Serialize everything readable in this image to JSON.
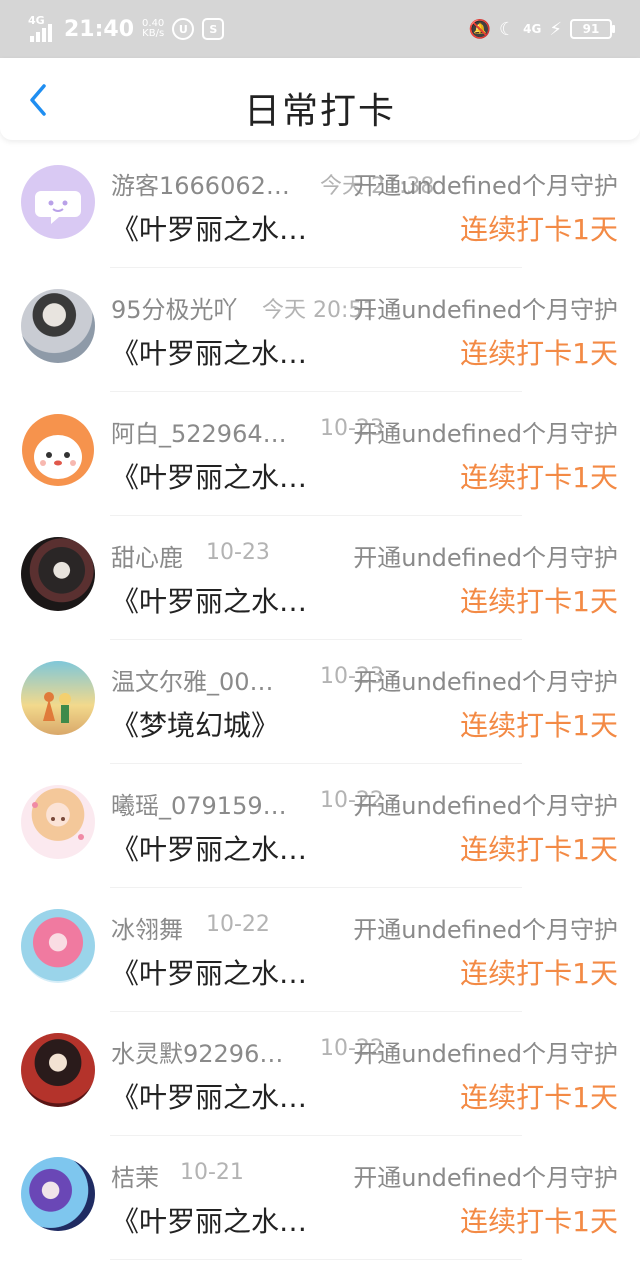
{
  "status_bar": {
    "network": "4G",
    "time": "21:40",
    "speed_value": "0.40",
    "speed_unit": "KB/s",
    "network2": "4G",
    "battery": "91"
  },
  "header": {
    "title": "日常打卡"
  },
  "colors": {
    "accent": "#1f8ef1",
    "streak": "#f38a45",
    "name": "#8a8a8a"
  },
  "rows": [
    {
      "name": "游客1666062…",
      "time": "今天 21:38",
      "guard": "开通undefined个月守护",
      "book": "《叶罗丽之水…",
      "streak": "连续打卡1天"
    },
    {
      "name": "95分极光吖",
      "time": "今天 20:51",
      "guard": "开通undefined个月守护",
      "book": "《叶罗丽之水…",
      "streak": "连续打卡1天"
    },
    {
      "name": "阿白_522964…",
      "time": "10-23",
      "guard": "开通undefined个月守护",
      "book": "《叶罗丽之水…",
      "streak": "连续打卡1天"
    },
    {
      "name": "甜心鹿",
      "time": "10-23",
      "guard": "开通undefined个月守护",
      "book": "《叶罗丽之水…",
      "streak": "连续打卡1天"
    },
    {
      "name": "温文尔雅_00…",
      "time": "10-23",
      "guard": "开通undefined个月守护",
      "book": "《梦境幻城》",
      "streak": "连续打卡1天"
    },
    {
      "name": "曦瑶_079159…",
      "time": "10-22",
      "guard": "开通undefined个月守护",
      "book": "《叶罗丽之水…",
      "streak": "连续打卡1天"
    },
    {
      "name": "冰翎舞",
      "time": "10-22",
      "guard": "开通undefined个月守护",
      "book": "《叶罗丽之水…",
      "streak": "连续打卡1天"
    },
    {
      "name": "水灵默92296…",
      "time": "10-22",
      "guard": "开通undefined个月守护",
      "book": "《叶罗丽之水…",
      "streak": "连续打卡1天"
    },
    {
      "name": "桔茉",
      "time": "10-21",
      "guard": "开通undefined个月守护",
      "book": "《叶罗丽之水…",
      "streak": "连续打卡1天"
    }
  ]
}
